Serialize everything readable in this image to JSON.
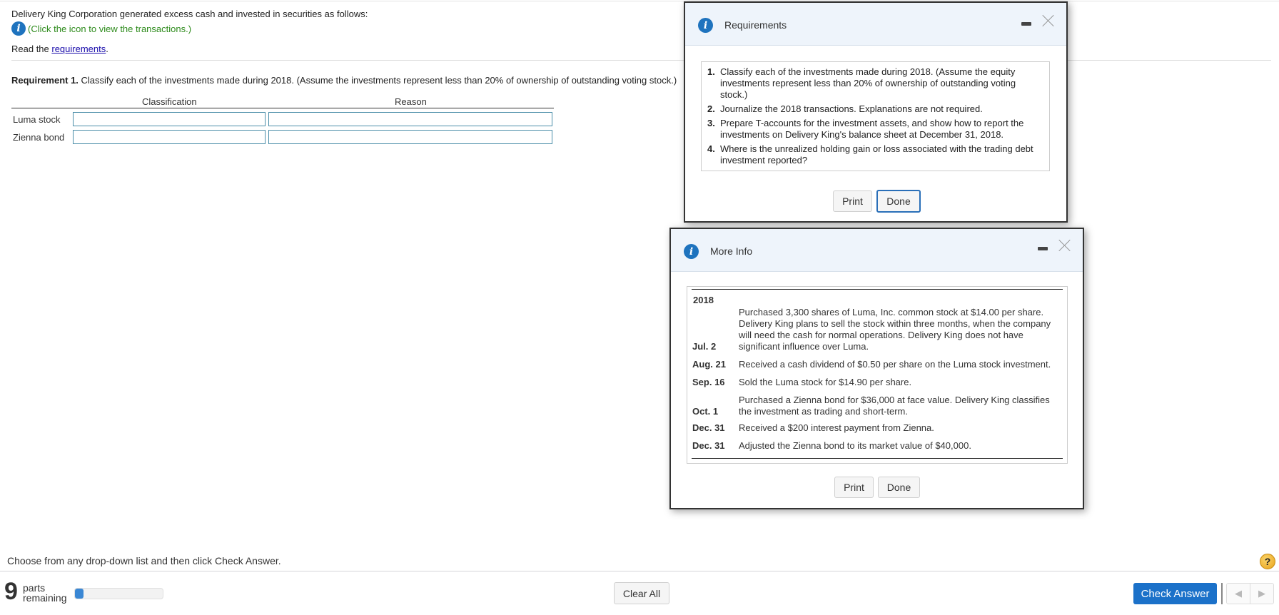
{
  "page": {
    "intro": "Delivery King Corporation generated excess cash and invested in securities as follows:",
    "info_hint": "(Click the icon to view the transactions.)",
    "read_prefix": "Read the ",
    "read_link": "requirements",
    "read_suffix": ".",
    "requirement_label": "Requirement 1.",
    "requirement_text": " Classify each of the investments made during 2018. (Assume the investments represent less than 20% of ownership of outstanding voting stock.)"
  },
  "classification_table": {
    "headers": [
      "Classification",
      "Reason"
    ],
    "rows": [
      {
        "label": "Luma stock",
        "classification": "",
        "reason": ""
      },
      {
        "label": "Zienna bond",
        "classification": "",
        "reason": ""
      }
    ]
  },
  "requirements_dialog": {
    "title": "Requirements",
    "items": [
      {
        "num": "1.",
        "text": "Classify each of the investments made during 2018. (Assume the equity investments represent less than 20% of ownership of outstanding voting stock.)"
      },
      {
        "num": "2.",
        "text": "Journalize the 2018 transactions. Explanations are not required."
      },
      {
        "num": "3.",
        "text": "Prepare T-accounts for the investment assets, and show how to report the investments on Delivery King's balance sheet at December 31, 2018."
      },
      {
        "num": "4.",
        "text": "Where is the unrealized holding gain or loss associated with the trading debt investment reported?"
      }
    ],
    "print_label": "Print",
    "done_label": "Done"
  },
  "more_info_dialog": {
    "title": "More Info",
    "year": "2018",
    "transactions": [
      {
        "date": "Jul. 2",
        "description": "Purchased 3,300 shares of Luma, Inc. common stock at $14.00 per share. Delivery King plans to sell the stock within three months, when the company will need the cash for normal operations. Delivery King does not have significant influence over Luma."
      },
      {
        "date": "Aug. 21",
        "description": "Received a cash dividend of $0.50 per share on the Luma stock investment."
      },
      {
        "date": "Sep. 16",
        "description": "Sold the Luma stock for $14.90 per share."
      },
      {
        "date": "Oct. 1",
        "description": "Purchased a Zienna bond for $36,000 at face value. Delivery King classifies the investment as trading and short-term."
      },
      {
        "date": "Dec. 31",
        "description": "Received a $200 interest payment from Zienna."
      },
      {
        "date": "Dec. 31",
        "description": "Adjusted the Zienna bond to its market value of $40,000."
      }
    ],
    "print_label": "Print",
    "done_label": "Done"
  },
  "footer": {
    "hint": "Choose from any drop-down list and then click Check Answer.",
    "parts_count": "9",
    "parts_label_1": "parts",
    "parts_label_2": "remaining",
    "progress_fraction": 0.1,
    "clear_all_label": "Clear All",
    "check_answer_label": "Check Answer",
    "help_glyph": "?",
    "prev_glyph": "◀",
    "next_glyph": "▶"
  },
  "colors": {
    "accent": "#1b71c9",
    "info_icon": "#1e73be",
    "hint_green": "#2e8b1c",
    "dialog_header": "#eef4fb"
  }
}
